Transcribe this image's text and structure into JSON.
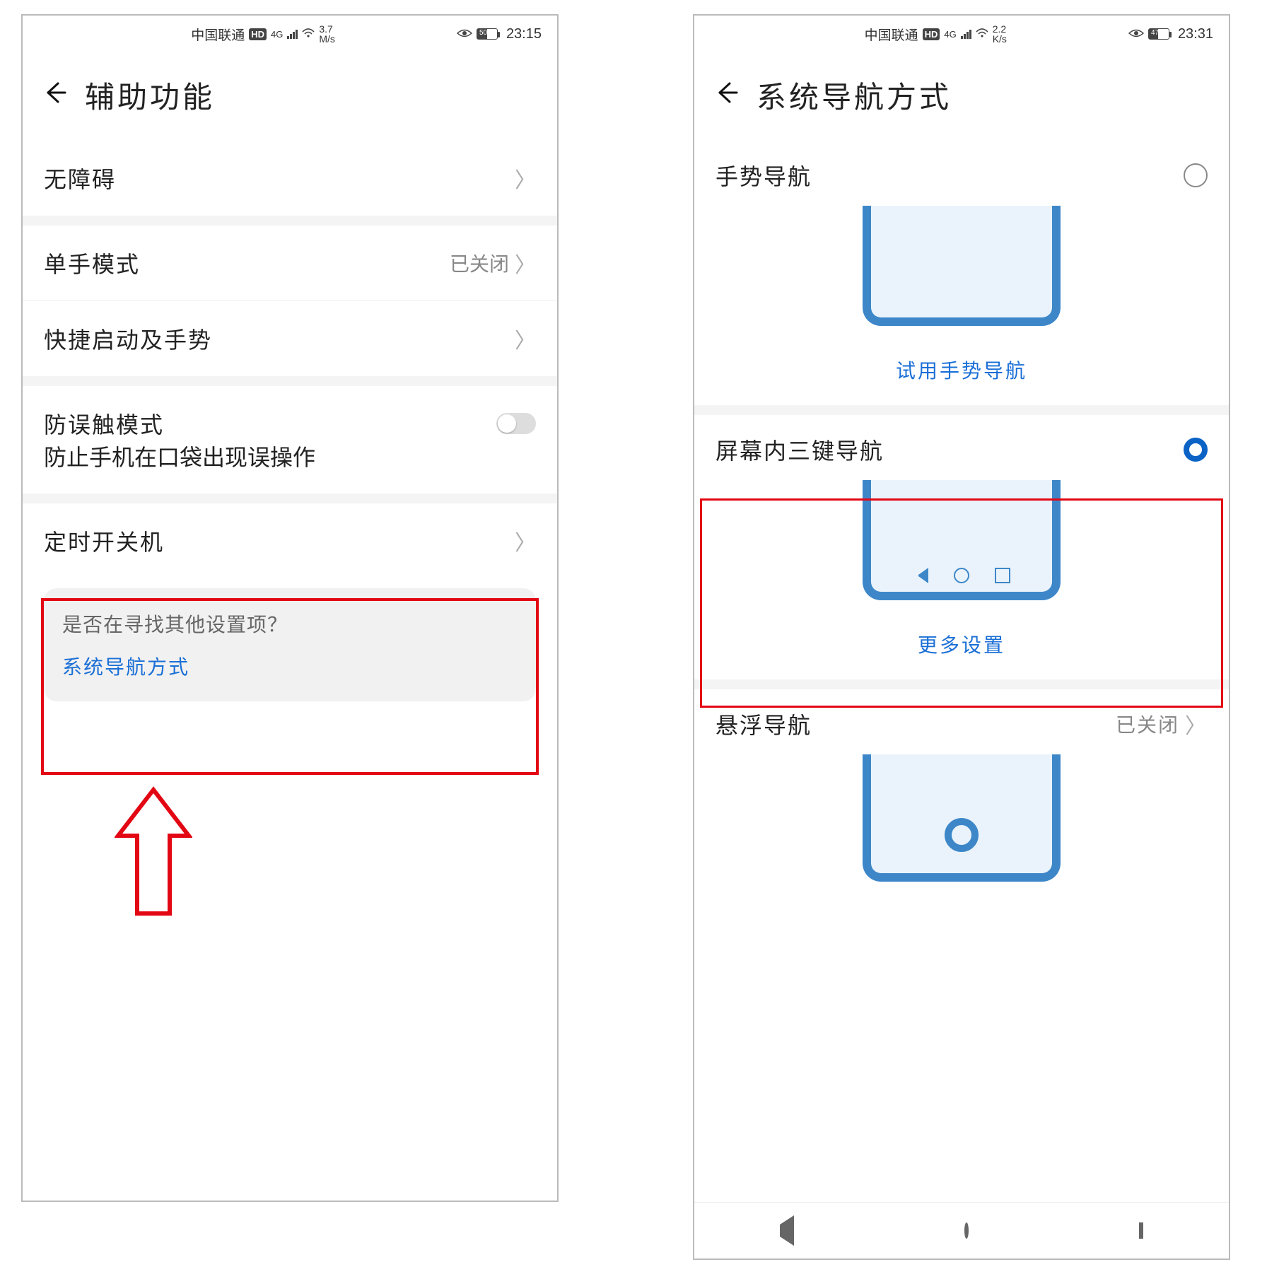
{
  "left": {
    "status": {
      "carrier": "中国联通",
      "net_badge": "HD",
      "net_gen": "4G",
      "speed_top": "3.7",
      "speed_bot": "M/s",
      "battery_pct": 50,
      "battery_text": "50",
      "time": "23:15"
    },
    "title": "辅助功能",
    "rows": {
      "accessibility": "无障碍",
      "one_hand": {
        "label": "单手模式",
        "value": "已关闭"
      },
      "shortcuts": "快捷启动及手势",
      "mistouch": {
        "label": "防误触模式",
        "sub": "防止手机在口袋出现误操作"
      },
      "schedule": "定时开关机"
    },
    "suggest": {
      "question": "是否在寻找其他设置项？",
      "link": "系统导航方式"
    }
  },
  "right": {
    "status": {
      "carrier": "中国联通",
      "net_badge": "HD",
      "net_gen": "4G",
      "speed_top": "2.2",
      "speed_bot": "K/s",
      "battery_pct": 47,
      "battery_text": "47",
      "time": "23:31"
    },
    "title": "系统导航方式",
    "options": {
      "gesture": {
        "label": "手势导航",
        "try_link": "试用手势导航"
      },
      "three_key": {
        "label": "屏幕内三键导航",
        "more_link": "更多设置"
      },
      "float": {
        "label": "悬浮导航",
        "value": "已关闭"
      }
    }
  }
}
